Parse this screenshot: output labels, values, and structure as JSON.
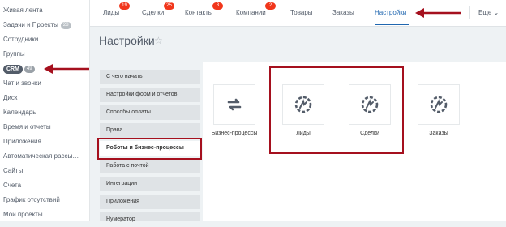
{
  "sidebar": {
    "items": [
      {
        "label": "Живая лента"
      },
      {
        "label": "Задачи и Проекты",
        "count": "28"
      },
      {
        "label": "Сотрудники"
      },
      {
        "label": "Группы"
      },
      {
        "label": "CRM",
        "count": "49"
      },
      {
        "label": "Чат и звонки"
      },
      {
        "label": "Диск"
      },
      {
        "label": "Календарь"
      },
      {
        "label": "Время и отчеты"
      },
      {
        "label": "Приложения"
      },
      {
        "label": "Автоматическая рассы…"
      },
      {
        "label": "Сайты"
      },
      {
        "label": "Счета"
      },
      {
        "label": "График отсутствий"
      },
      {
        "label": "Мои проекты"
      }
    ]
  },
  "topnav": {
    "items": [
      {
        "label": "Лиды",
        "badge": "19"
      },
      {
        "label": "Сделки",
        "badge": "25"
      },
      {
        "label": "Контакты",
        "badge": "3"
      },
      {
        "label": "Компании",
        "badge": "2"
      },
      {
        "label": "Товары"
      },
      {
        "label": "Заказы"
      },
      {
        "label": "Настройки"
      }
    ],
    "more_label": "Еще ⌄"
  },
  "page": {
    "title": "Настройки",
    "star": "☆"
  },
  "settings_menu": {
    "items": [
      {
        "label": "С чего начать"
      },
      {
        "label": "Настройки форм и отчетов"
      },
      {
        "label": "Способы оплаты"
      },
      {
        "label": "Права"
      },
      {
        "label": "Роботы и бизнес-процессы"
      },
      {
        "label": "Работа с почтой"
      },
      {
        "label": "Интеграции"
      },
      {
        "label": "Приложения"
      },
      {
        "label": "Нумератор"
      }
    ]
  },
  "tiles": [
    {
      "label": "Бизнес-процессы",
      "icon": "sync-arrows-icon"
    },
    {
      "label": "Лиды",
      "icon": "robot-gear-icon"
    },
    {
      "label": "Сделки",
      "icon": "robot-gear-icon"
    },
    {
      "label": "Заказы",
      "icon": "robot-gear-icon"
    }
  ],
  "colors": {
    "accent": "#2067b0",
    "badge": "#f1361b",
    "highlight": "#a5101e"
  }
}
